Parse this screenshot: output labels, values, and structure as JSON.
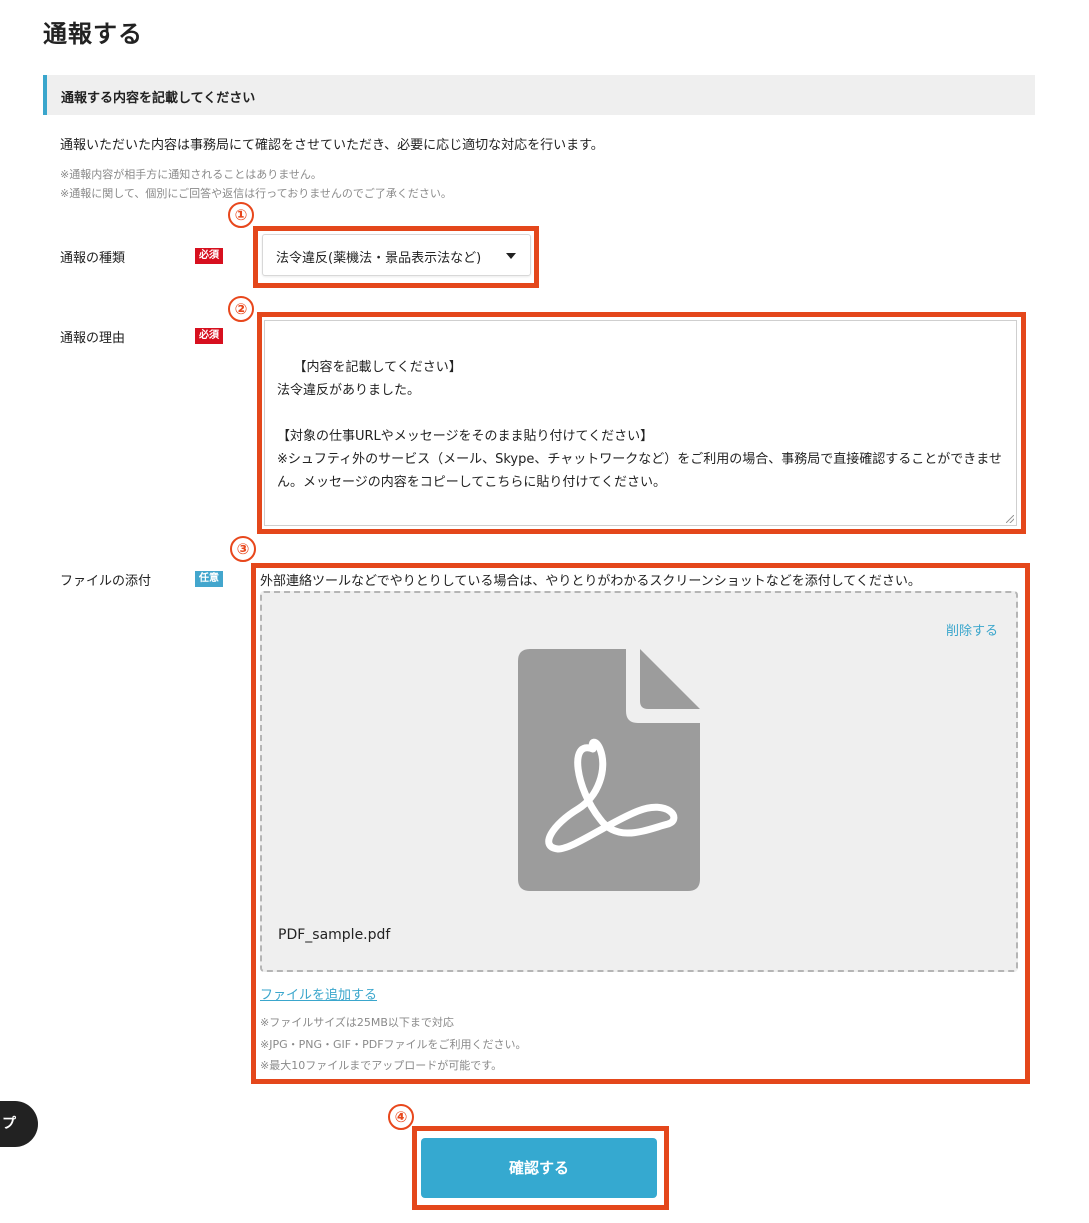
{
  "page": {
    "title": "通報する"
  },
  "section": {
    "header": "通報する内容を記載してください"
  },
  "intro": {
    "text": "通報いただいた内容は事務局にて確認をさせていただき、必要に応じ適切な対応を行います。",
    "notes": [
      "※通報内容が相手方に通知されることはありません。",
      "※通報に関して、個別にご回答や返信は行っておりませんのでご了承ください。"
    ]
  },
  "markers": [
    "①",
    "②",
    "③",
    "④"
  ],
  "fields": {
    "type": {
      "label": "通報の種類",
      "badge": "必須",
      "selected": "法令違反(薬機法・景品表示法など)"
    },
    "reason": {
      "label": "通報の理由",
      "badge": "必須",
      "value": "【内容を記載してください】\n法令違反がありました。\n\n【対象の仕事URLやメッセージをそのまま貼り付けてください】\n※シュフティ外のサービス（メール、Skype、チャットワークなど）をご利用の場合、事務局で直接確認することができません。メッセージの内容をコピーしてこちらに貼り付けてください。"
    },
    "attachment": {
      "label": "ファイルの添付",
      "badge": "任意",
      "description": "外部連絡ツールなどでやりとりしている場合は、やりとりがわかるスクリーンショットなどを添付してください。",
      "delete_label": "削除する",
      "file_name": "PDF_sample.pdf",
      "add_label": "ファイルを追加する",
      "notes": [
        "※ファイルサイズは25MB以下まで対応",
        "※JPG・PNG・GIF・PDFファイルをご利用ください。",
        "※最大10ファイルまでアップロードが可能です。"
      ]
    }
  },
  "floating_button": {
    "label": "プ"
  },
  "submit": {
    "label": "確認する"
  },
  "colors": {
    "accent": "#3aa6cc",
    "required": "#d7101f",
    "optional": "#43a6cd",
    "highlight": "#e4471b",
    "button": "#35a9d0"
  },
  "icons": [
    "pdf-file-icon",
    "chevron-down-icon"
  ]
}
